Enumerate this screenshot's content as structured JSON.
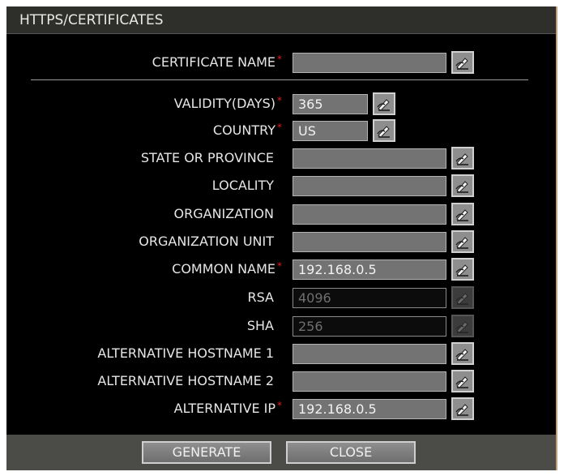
{
  "window": {
    "title": "HTTPS/CERTIFICATES"
  },
  "fields": {
    "certificate_name": {
      "label": "CERTIFICATE NAME",
      "value": "",
      "required": true
    },
    "validity_days": {
      "label": "VALIDITY(DAYS)",
      "value": "365",
      "required": true
    },
    "country": {
      "label": "COUNTRY",
      "value": "US",
      "required": true
    },
    "state": {
      "label": "STATE OR PROVINCE",
      "value": ""
    },
    "locality": {
      "label": "LOCALITY",
      "value": ""
    },
    "organization": {
      "label": "ORGANIZATION",
      "value": ""
    },
    "org_unit": {
      "label": "ORGANIZATION UNIT",
      "value": ""
    },
    "common_name": {
      "label": "COMMON NAME",
      "value": "192.168.0.5",
      "required": true
    },
    "rsa": {
      "label": "RSA",
      "value": "4096",
      "disabled": true
    },
    "sha": {
      "label": "SHA",
      "value": "256",
      "disabled": true
    },
    "alt_host1": {
      "label": "ALTERNATIVE HOSTNAME 1",
      "value": ""
    },
    "alt_host2": {
      "label": "ALTERNATIVE HOSTNAME 2",
      "value": ""
    },
    "alt_ip": {
      "label": "ALTERNATIVE IP",
      "value": "192.168.0.5",
      "required": true
    }
  },
  "required_marker": "*",
  "buttons": {
    "generate": "GENERATE",
    "close": "CLOSE"
  },
  "icons": {
    "keyboard": "keyboard-edit-icon"
  },
  "colors": {
    "background": "#000000",
    "field": "#737373",
    "disabled_field": "#0c0c0c",
    "required": "#e02020"
  }
}
